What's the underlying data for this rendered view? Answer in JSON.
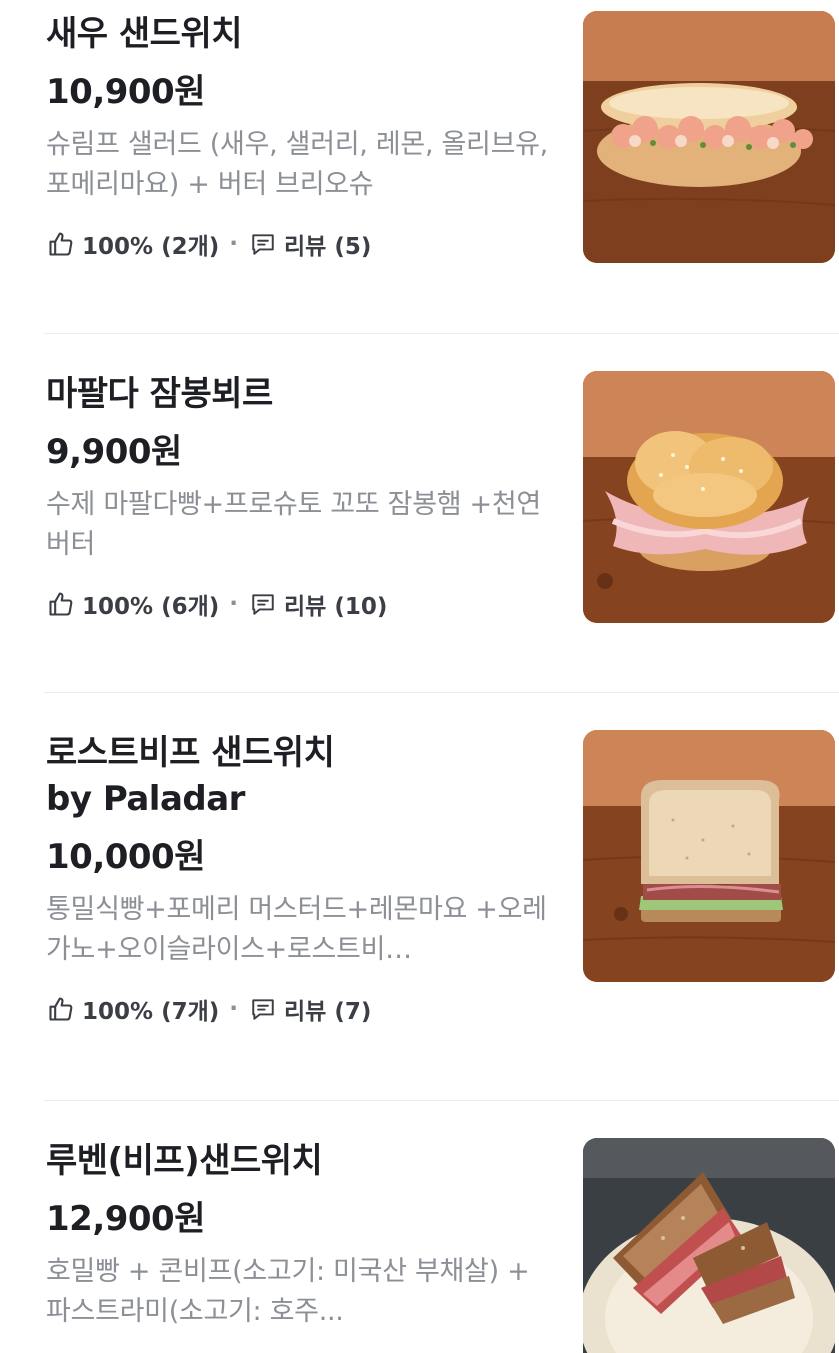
{
  "items": [
    {
      "name_lines": [
        "새우 샌드위치"
      ],
      "price": "10,900원",
      "description": "슈림프 샐러드 (새우, 샐러리, 레몬, 올리브유, 포메리마요) + 버터 브리오슈",
      "likes": "100% (2개)",
      "reviews": "리뷰 (5)",
      "image": "shrimp-sandwich-photo"
    },
    {
      "name_lines": [
        "마팔다 잠봉뵈르"
      ],
      "price": "9,900원",
      "description": "수제 마팔다빵+프로슈토 꼬또 잠봉햄 +천연버터",
      "likes": "100% (6개)",
      "reviews": "리뷰 (10)",
      "image": "mafalda-jambon-beurre-photo"
    },
    {
      "name_lines": [
        "로스트비프 샌드위치",
        "by Paladar"
      ],
      "price": "10,000원",
      "description": "통밀식빵+포메리 머스터드+레몬마요 +오레가노+오이슬라이스+로스트비…",
      "likes": "100% (7개)",
      "reviews": "리뷰 (7)",
      "image": "roast-beef-sandwich-photo"
    },
    {
      "name_lines": [
        "루벤(비프)샌드위치"
      ],
      "price": "12,900원",
      "description": "호밀빵 + 콘비프(소고기: 미국산 부채살) + 파스트라미(소고기: 호주...",
      "image": "reuben-sandwich-photo"
    }
  ],
  "icons": {
    "like": "thumbs-up-icon",
    "review": "comment-icon"
  },
  "colors": {
    "title": "#1e1f24",
    "description": "#8c8f96",
    "divider": "#ebecef",
    "board": "#8a4a25"
  }
}
